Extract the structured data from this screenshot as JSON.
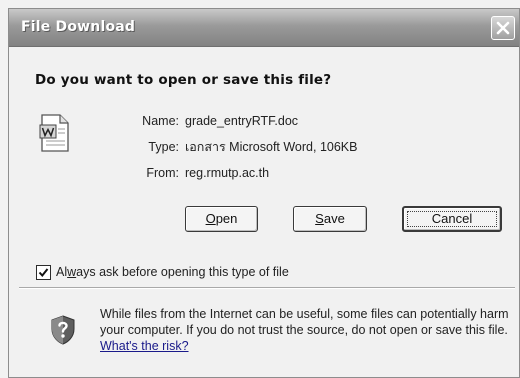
{
  "window": {
    "title": "File Download"
  },
  "dialog": {
    "question": "Do you want to open or save this file?",
    "file_icon": "word-document-icon",
    "info": [
      {
        "label": "Name:",
        "value": "grade_entryRTF.doc"
      },
      {
        "label": "Type:",
        "value": "เอกสาร Microsoft Word, 106KB"
      },
      {
        "label": "From:",
        "value": "reg.rmutp.ac.th"
      }
    ]
  },
  "buttons": {
    "open": {
      "mnemonic": "O",
      "rest": "pen"
    },
    "save": {
      "mnemonic": "S",
      "rest": "ave"
    },
    "cancel": "Cancel"
  },
  "checkbox": {
    "checked": true,
    "label_before": "Al",
    "label_mnemonic": "w",
    "label_after": "ays ask before opening this type of file"
  },
  "warning": {
    "icon": "shield-question-icon",
    "text": "While files from the Internet can be useful, some files can potentially harm your computer. If you do not trust the source, do not open or save this file. ",
    "link": "What's the risk?"
  }
}
